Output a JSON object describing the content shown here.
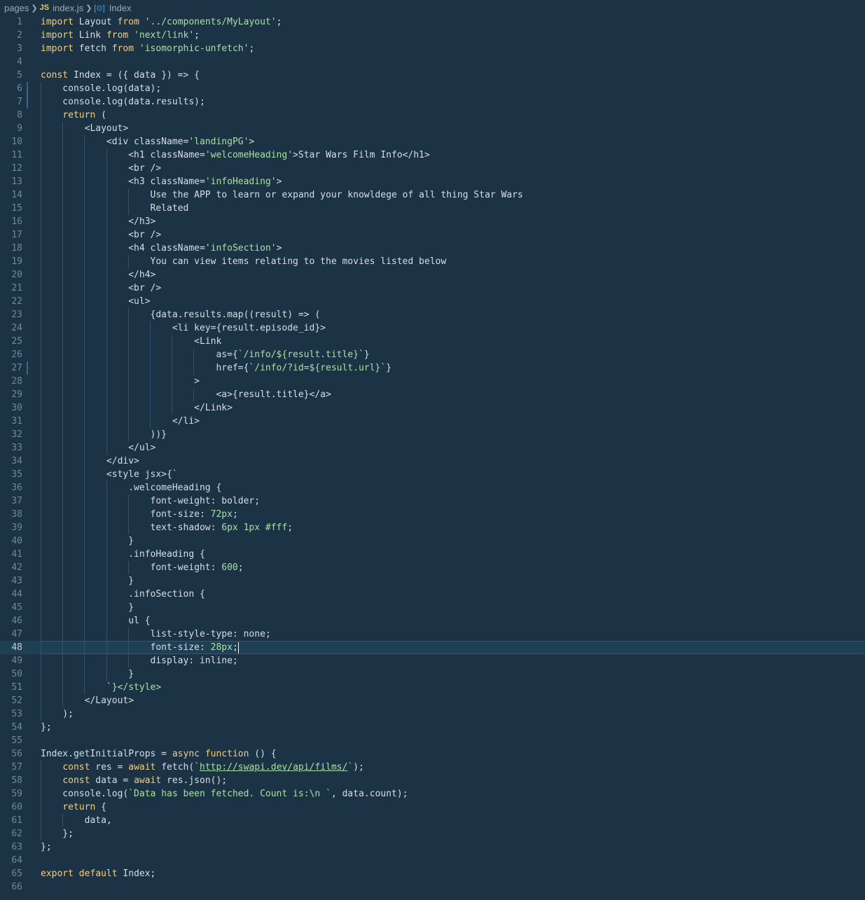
{
  "breadcrumb": {
    "folder": "pages",
    "file_lang": "JS",
    "file": "index.js",
    "symbol": "Index"
  },
  "editor": {
    "current_line": 48,
    "lines": [
      "import Layout from '../components/MyLayout';",
      "import Link from 'next/link';",
      "import fetch from 'isomorphic-unfetch';",
      "",
      "const Index = ({ data }) => {",
      "    console.log(data);",
      "    console.log(data.results);",
      "    return (",
      "        <Layout>",
      "            <div className='landingPG'>",
      "                <h1 className='welcomeHeading'>Star Wars Film Info</h1>",
      "                <br />",
      "                <h3 className='infoHeading'>",
      "                    Use the APP to learn or expand your knowldege of all thing Star Wars",
      "                    Related",
      "                </h3>",
      "                <br />",
      "                <h4 className='infoSection'>",
      "                    You can view items relating to the movies listed below",
      "                </h4>",
      "                <br />",
      "                <ul>",
      "                    {data.results.map((result) => (",
      "                        <li key={result.episode_id}>",
      "                            <Link",
      "                                as={`/info/${result.title}`}",
      "                                href={`/info/?id=${result.url}`}",
      "                            >",
      "                                <a>{result.title}</a>",
      "                            </Link>",
      "                        </li>",
      "                    ))}",
      "                </ul>",
      "            </div>",
      "            <style jsx>{`",
      "                .welcomeHeading {",
      "                    font-weight: bolder;",
      "                    font-size: 72px;",
      "                    text-shadow: 6px 1px #fff;",
      "                }",
      "                .infoHeading {",
      "                    font-weight: 600;",
      "                }",
      "                .infoSection {",
      "                }",
      "                ul {",
      "                    list-style-type: none;",
      "                    font-size: 28px;",
      "                    display: inline;",
      "                }",
      "            `}</style>",
      "        </Layout>",
      "    );",
      "};",
      "",
      "Index.getInitialProps = async function () {",
      "    const res = await fetch(`http://swapi.dev/api/films/`);",
      "    const data = await res.json();",
      "    console.log(`Data has been fetched. Count is:\\n `, data.count);",
      "    return {",
      "        data,",
      "    };",
      "};",
      "",
      "export default Index;",
      ""
    ]
  }
}
